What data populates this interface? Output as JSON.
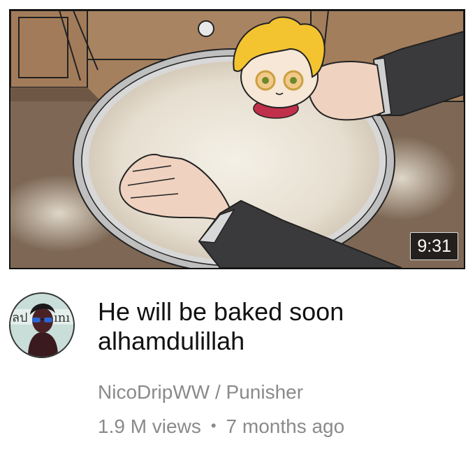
{
  "video": {
    "duration": "9:31",
    "title": "He will be baked soon alhamdulillah",
    "channel_name": "NicoDripWW / Punisher",
    "views": "1.9 M views",
    "separator": "•",
    "age": "7 months ago"
  },
  "avatar": {
    "banner_text_left": "ลป",
    "banner_text_right": "ını"
  },
  "colors": {
    "title": "#111111",
    "meta": "#8a8a8a",
    "duration_bg": "#141414",
    "cabinet_wood": "#a5805f",
    "flour": "#e9e3d6",
    "hair": "#f4c430",
    "sleeve": "#3a3a3c",
    "skin": "#efd2c0"
  }
}
